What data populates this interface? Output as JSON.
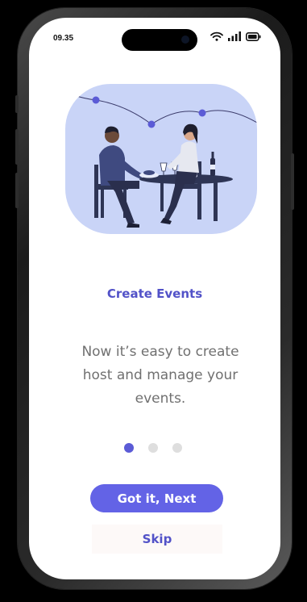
{
  "status_bar": {
    "time": "09.35",
    "icons": [
      "wifi-icon",
      "cellular-signal-icon",
      "battery-icon"
    ]
  },
  "onboarding": {
    "illustration": "dinner-event-illustration",
    "title": "Create Events",
    "description": "Now it’s easy to create host and manage your events.",
    "page_indicator": {
      "total": 3,
      "active": 1
    },
    "primary_button": "Got it, Next",
    "secondary_button": "Skip"
  },
  "colors": {
    "accent": "#5252c8",
    "button": "#6363e6",
    "illustration_bg": "#c9d4f7",
    "body_text": "#707070",
    "dot_inactive": "#dedede"
  }
}
